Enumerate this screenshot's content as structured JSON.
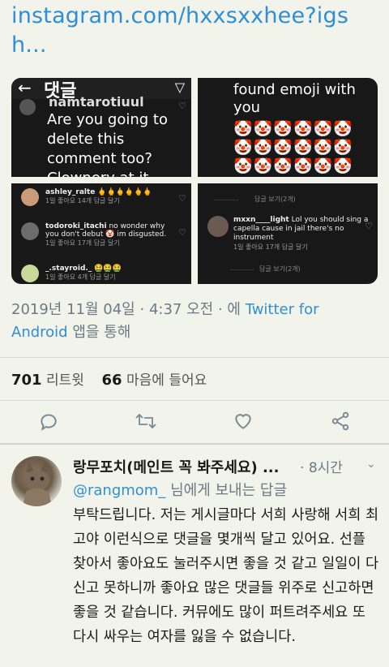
{
  "tweet": {
    "url_text": "instagram.com/hxxsxxhee?igsh...",
    "date": "2019년 11월 04일",
    "time": "4:37 오전",
    "via_prefix": "에",
    "source": "Twitter for Android",
    "via_suffix": "앱을 통해",
    "retweets": "701",
    "retweets_label": "리트윗",
    "likes": "66",
    "likes_label": "마음에 들어요"
  },
  "media": {
    "tile1": {
      "title": "댓글",
      "username_cut": "namtarotiuul",
      "text": "Are you going to delete this comment too? Clownery at it"
    },
    "tile2": {
      "text": "found emoji with you",
      "emoji_rows": [
        "🤡🤡🤡🤡🤡🤡",
        "🤡🤡🤡🤡🤡🤡",
        "🤡🤡🤡🤡🤡🤡"
      ]
    },
    "tile3": {
      "comments": [
        {
          "user": "ashley_ralte",
          "text": "🖕🖕🖕🖕🖕🖕",
          "meta": "1일   좋아요 14개   답글 달기"
        },
        {
          "user": "todoroki_itachi",
          "text": "no wonder why you don't debut 🤡 im disgusted.",
          "meta": "1일   좋아요 17개   답글 달기"
        },
        {
          "user": "_.stayroid._",
          "text": "🤮🤮🤮",
          "meta": "1일   좋아요 4개   답글 달기"
        }
      ]
    },
    "tile4": {
      "reply_header": "답글 보기(2개)",
      "user": "mxxn____light",
      "text": "Lol you should sing a capella cause in jail there's no instrument",
      "meta": "1일   좋아요 17개   답글 달기",
      "reply_footer": "답글 보기(2개)"
    }
  },
  "reply": {
    "name": "랑무포치(메인트 꼭 봐주세요) ...",
    "time": "8시간",
    "to_handle": "@rangmom_",
    "to_suffix": "님에게 보내는 답글",
    "body": "부탁드립니다. 저는 게시글마다 서희 사랑해 서희 최고야 이런식으로 댓글을 몇개씩 달고 있어요. 선플 찾아서 좋아요도 눌러주시면 좋을 것 같고 일일이 다 신고 못하니까 좋아요 많은 댓글들 위주로 신고하면 좋을 것 같습니다. 커뮤에도 많이 퍼트려주세요 또 다시 싸우는 여자를 잃을 수 없습니다."
  },
  "colors": {
    "background": "#f2f3ea",
    "link": "#2e8fd6",
    "meta_text": "#6b7b86",
    "media_bg": "#181818"
  }
}
